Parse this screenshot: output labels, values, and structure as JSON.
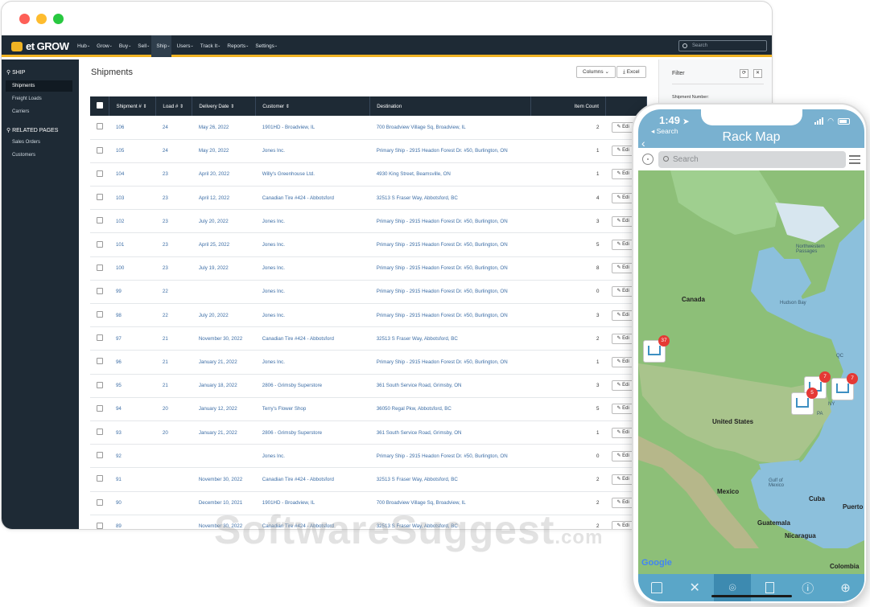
{
  "browser": {
    "logo_text": "et GROW",
    "menu": [
      "Hub",
      "Grow",
      "Buy",
      "Sell",
      "Ship",
      "Users",
      "Track It",
      "Reports",
      "Settings"
    ],
    "active_menu": "Ship",
    "search_placeholder": "Search"
  },
  "sidebar": {
    "section": "SHIP",
    "items": [
      "Shipments",
      "Freight Loads",
      "Carriers"
    ],
    "related_header": "RELATED PAGES",
    "related": [
      "Sales Orders",
      "Customers"
    ]
  },
  "main": {
    "title": "Shipments",
    "columns_btn": "Columns",
    "excel_btn": "Excel",
    "headers": [
      "Shipment #",
      "Load #",
      "Delivery Date",
      "Customer",
      "Destination",
      "Item Count"
    ],
    "edit_label": "Edi",
    "rows": [
      [
        "106",
        "24",
        "May 26, 2022",
        "1901HD - Broadview, IL",
        "700 Broadview Village Sq, Broadview, IL",
        "2"
      ],
      [
        "105",
        "24",
        "May 20, 2022",
        "Jones Inc.",
        "Primary Ship - 2915 Headon Forest Dr. #50, Burlington, ON",
        "1"
      ],
      [
        "104",
        "23",
        "April 20, 2022",
        "Willy's Greenhouse Ltd.",
        "4930 King Street, Beamsville, ON",
        "1"
      ],
      [
        "103",
        "23",
        "April 12, 2022",
        "Canadian Tire #424 - Abbotsford",
        "32513 S Fraser Way, Abbotsford, BC",
        "4"
      ],
      [
        "102",
        "23",
        "July 20, 2022",
        "Jones Inc.",
        "Primary Ship - 2915 Headon Forest Dr. #50, Burlington, ON",
        "3"
      ],
      [
        "101",
        "23",
        "April 25, 2022",
        "Jones Inc.",
        "Primary Ship - 2915 Headon Forest Dr. #50, Burlington, ON",
        "5"
      ],
      [
        "100",
        "23",
        "July 19, 2022",
        "Jones Inc.",
        "Primary Ship - 2915 Headon Forest Dr. #50, Burlington, ON",
        "8"
      ],
      [
        "99",
        "22",
        "",
        "Jones Inc.",
        "Primary Ship - 2915 Headon Forest Dr. #50, Burlington, ON",
        "0"
      ],
      [
        "98",
        "22",
        "July 20, 2022",
        "Jones Inc.",
        "Primary Ship - 2915 Headon Forest Dr. #50, Burlington, ON",
        "3"
      ],
      [
        "97",
        "21",
        "November 30, 2022",
        "Canadian Tire #424 - Abbotsford",
        "32513 S Fraser Way, Abbotsford, BC",
        "2"
      ],
      [
        "96",
        "21",
        "January 21, 2022",
        "Jones Inc.",
        "Primary Ship - 2915 Headon Forest Dr. #50, Burlington, ON",
        "1"
      ],
      [
        "95",
        "21",
        "January 18, 2022",
        "2806 - Grimsby Superstore",
        "361 South Service Road, Grimsby, ON",
        "3"
      ],
      [
        "94",
        "20",
        "January 12, 2022",
        "Terry's Flower Shop",
        "36050 Regal Pkw, Abbotsford, BC",
        "5"
      ],
      [
        "93",
        "20",
        "January 21, 2022",
        "2806 - Grimsby Superstore",
        "361 South Service Road, Grimsby, ON",
        "1"
      ],
      [
        "92",
        "",
        "",
        "Jones Inc.",
        "Primary Ship - 2915 Headon Forest Dr. #50, Burlington, ON",
        "0"
      ],
      [
        "91",
        "",
        "November 30, 2022",
        "Canadian Tire #424 - Abbotsford",
        "32513 S Fraser Way, Abbotsford, BC",
        "2"
      ],
      [
        "90",
        "",
        "December 10, 2021",
        "1901HD - Broadview, IL",
        "700 Broadview Village Sq, Broadview, IL",
        "2"
      ],
      [
        "89",
        "",
        "November 30, 2022",
        "Canadian Tire #424 - Abbotsford",
        "32513 S Fraser Way, Abbotsford, BC",
        "2"
      ]
    ]
  },
  "filter": {
    "title": "Filter",
    "label": "Shipment Number:"
  },
  "phone": {
    "time": "1:49",
    "back_app": "Search",
    "title": "Rack Map",
    "search_placeholder": "Search",
    "map_labels": {
      "canada": "Canada",
      "united_states": "United States",
      "mexico": "Mexico",
      "cuba": "Cuba",
      "guatemala": "Guatemala",
      "nicaragua": "Nicaragua",
      "colombia": "Colombia",
      "hudson_bay": "Hudson Bay",
      "northwestern_passages": "Northwestern Passages",
      "gulf_of_mexico": "Gulf of Mexico",
      "puerto": "Puerto",
      "qc": "QC",
      "ny": "NY",
      "pa": "PA"
    },
    "pins": [
      "37",
      "7",
      "7",
      "5"
    ],
    "google": "Google"
  },
  "watermark": {
    "text": "SoftwareSuggest",
    "suffix": ".com"
  }
}
